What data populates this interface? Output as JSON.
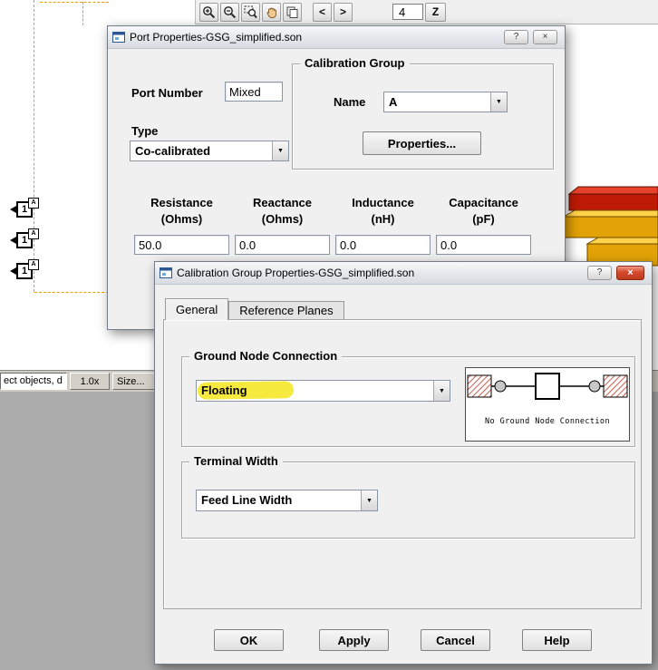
{
  "colors": {
    "highlight_yellow": "#F6E82E",
    "layout_orange": "#EE9C00",
    "metal_gold_top": "#FFD24A",
    "metal_gold_front": "#E3A306",
    "metal_red_top": "#E8422C",
    "metal_red_front": "#BE1A06",
    "close_button_red": "#BE3A1E"
  },
  "toolbar": {
    "icons": [
      "zoom-in",
      "zoom-out",
      "zoom-area",
      "pan-hand",
      "duplicate-view",
      "prev-arrow",
      "next-arrow"
    ],
    "prev_label": "<",
    "next_label": ">",
    "level_value": "4",
    "z_button_label": "Z"
  },
  "canvas": {
    "ports": [
      {
        "number": "1",
        "group": "A"
      },
      {
        "number": "1",
        "group": "A"
      },
      {
        "number": "1",
        "group": "A"
      }
    ]
  },
  "status_bar": {
    "selection_text": "ect objects, d",
    "zoom_level": "1.0x",
    "size_button_label": "Size..."
  },
  "ui_icons": {
    "dropdown_arrow": "▼",
    "help_glyph": "?",
    "close_glyph": "×"
  },
  "port_dialog": {
    "title": "Port Properties-GSG_simplified.son",
    "port_number_label": "Port Number",
    "port_number_value": "Mixed",
    "type_label": "Type",
    "type_value": "Co-calibrated",
    "calibration_group": {
      "legend": "Calibration Group",
      "name_label": "Name",
      "name_value": "A",
      "properties_button": "Properties..."
    },
    "param_columns": [
      {
        "title": "Resistance",
        "unit": "(Ohms)",
        "value": "50.0"
      },
      {
        "title": "Reactance",
        "unit": "(Ohms)",
        "value": "0.0"
      },
      {
        "title": "Inductance",
        "unit": "(nH)",
        "value": "0.0"
      },
      {
        "title": "Capacitance",
        "unit": "(pF)",
        "value": "0.0"
      }
    ]
  },
  "calib_dialog": {
    "title": "Calibration Group Properties-GSG_simplified.son",
    "tabs": [
      {
        "label": "General"
      },
      {
        "label": "Reference Planes"
      }
    ],
    "ground_group": {
      "legend": "Ground Node Connection",
      "combo_value": "Floating",
      "diagram_caption": "No Ground Node Connection"
    },
    "terminal_group": {
      "legend": "Terminal Width",
      "combo_value": "Feed Line Width"
    },
    "buttons": [
      {
        "label": "OK"
      },
      {
        "label": "Apply"
      },
      {
        "label": "Cancel"
      },
      {
        "label": "Help"
      }
    ]
  }
}
